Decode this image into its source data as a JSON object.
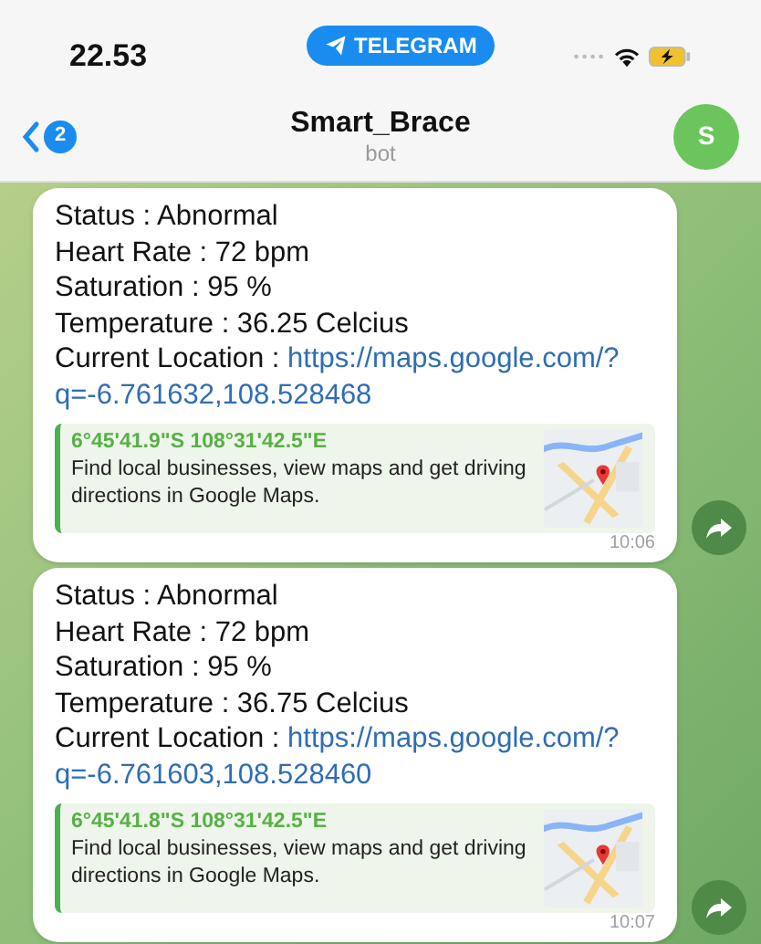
{
  "status_bar": {
    "time": "22.53",
    "app_pill": "TELEGRAM"
  },
  "header": {
    "unread_count": "2",
    "title": "Smart_Brace",
    "subtitle": "bot",
    "avatar_letter": "S"
  },
  "messages": [
    {
      "lines": [
        "Status : Abnormal",
        "Heart Rate : 72 bpm",
        "Saturation : 95 %",
        "Temperature : 36.25 Celcius"
      ],
      "location_label": "Current Location : ",
      "location_url_lines": [
        "https://maps.google.com/?",
        "q=-6.761632,108.528468"
      ],
      "preview": {
        "title": "6°45'41.9\"S 108°31'42.5\"E",
        "description": "Find local businesses, view maps and get driving directions in Google Maps."
      },
      "time": "10:06"
    },
    {
      "lines": [
        "Status : Abnormal",
        "Heart Rate : 72 bpm",
        "Saturation : 95 %",
        "Temperature : 36.75 Celcius"
      ],
      "location_label": "Current Location : ",
      "location_url_lines": [
        "https://maps.google.com/?",
        "q=-6.761603,108.528460"
      ],
      "preview": {
        "title": "6°45'41.8\"S 108°31'42.5\"E",
        "description": "Find local businesses, view maps and get driving directions in Google Maps."
      },
      "time": "10:07"
    }
  ]
}
